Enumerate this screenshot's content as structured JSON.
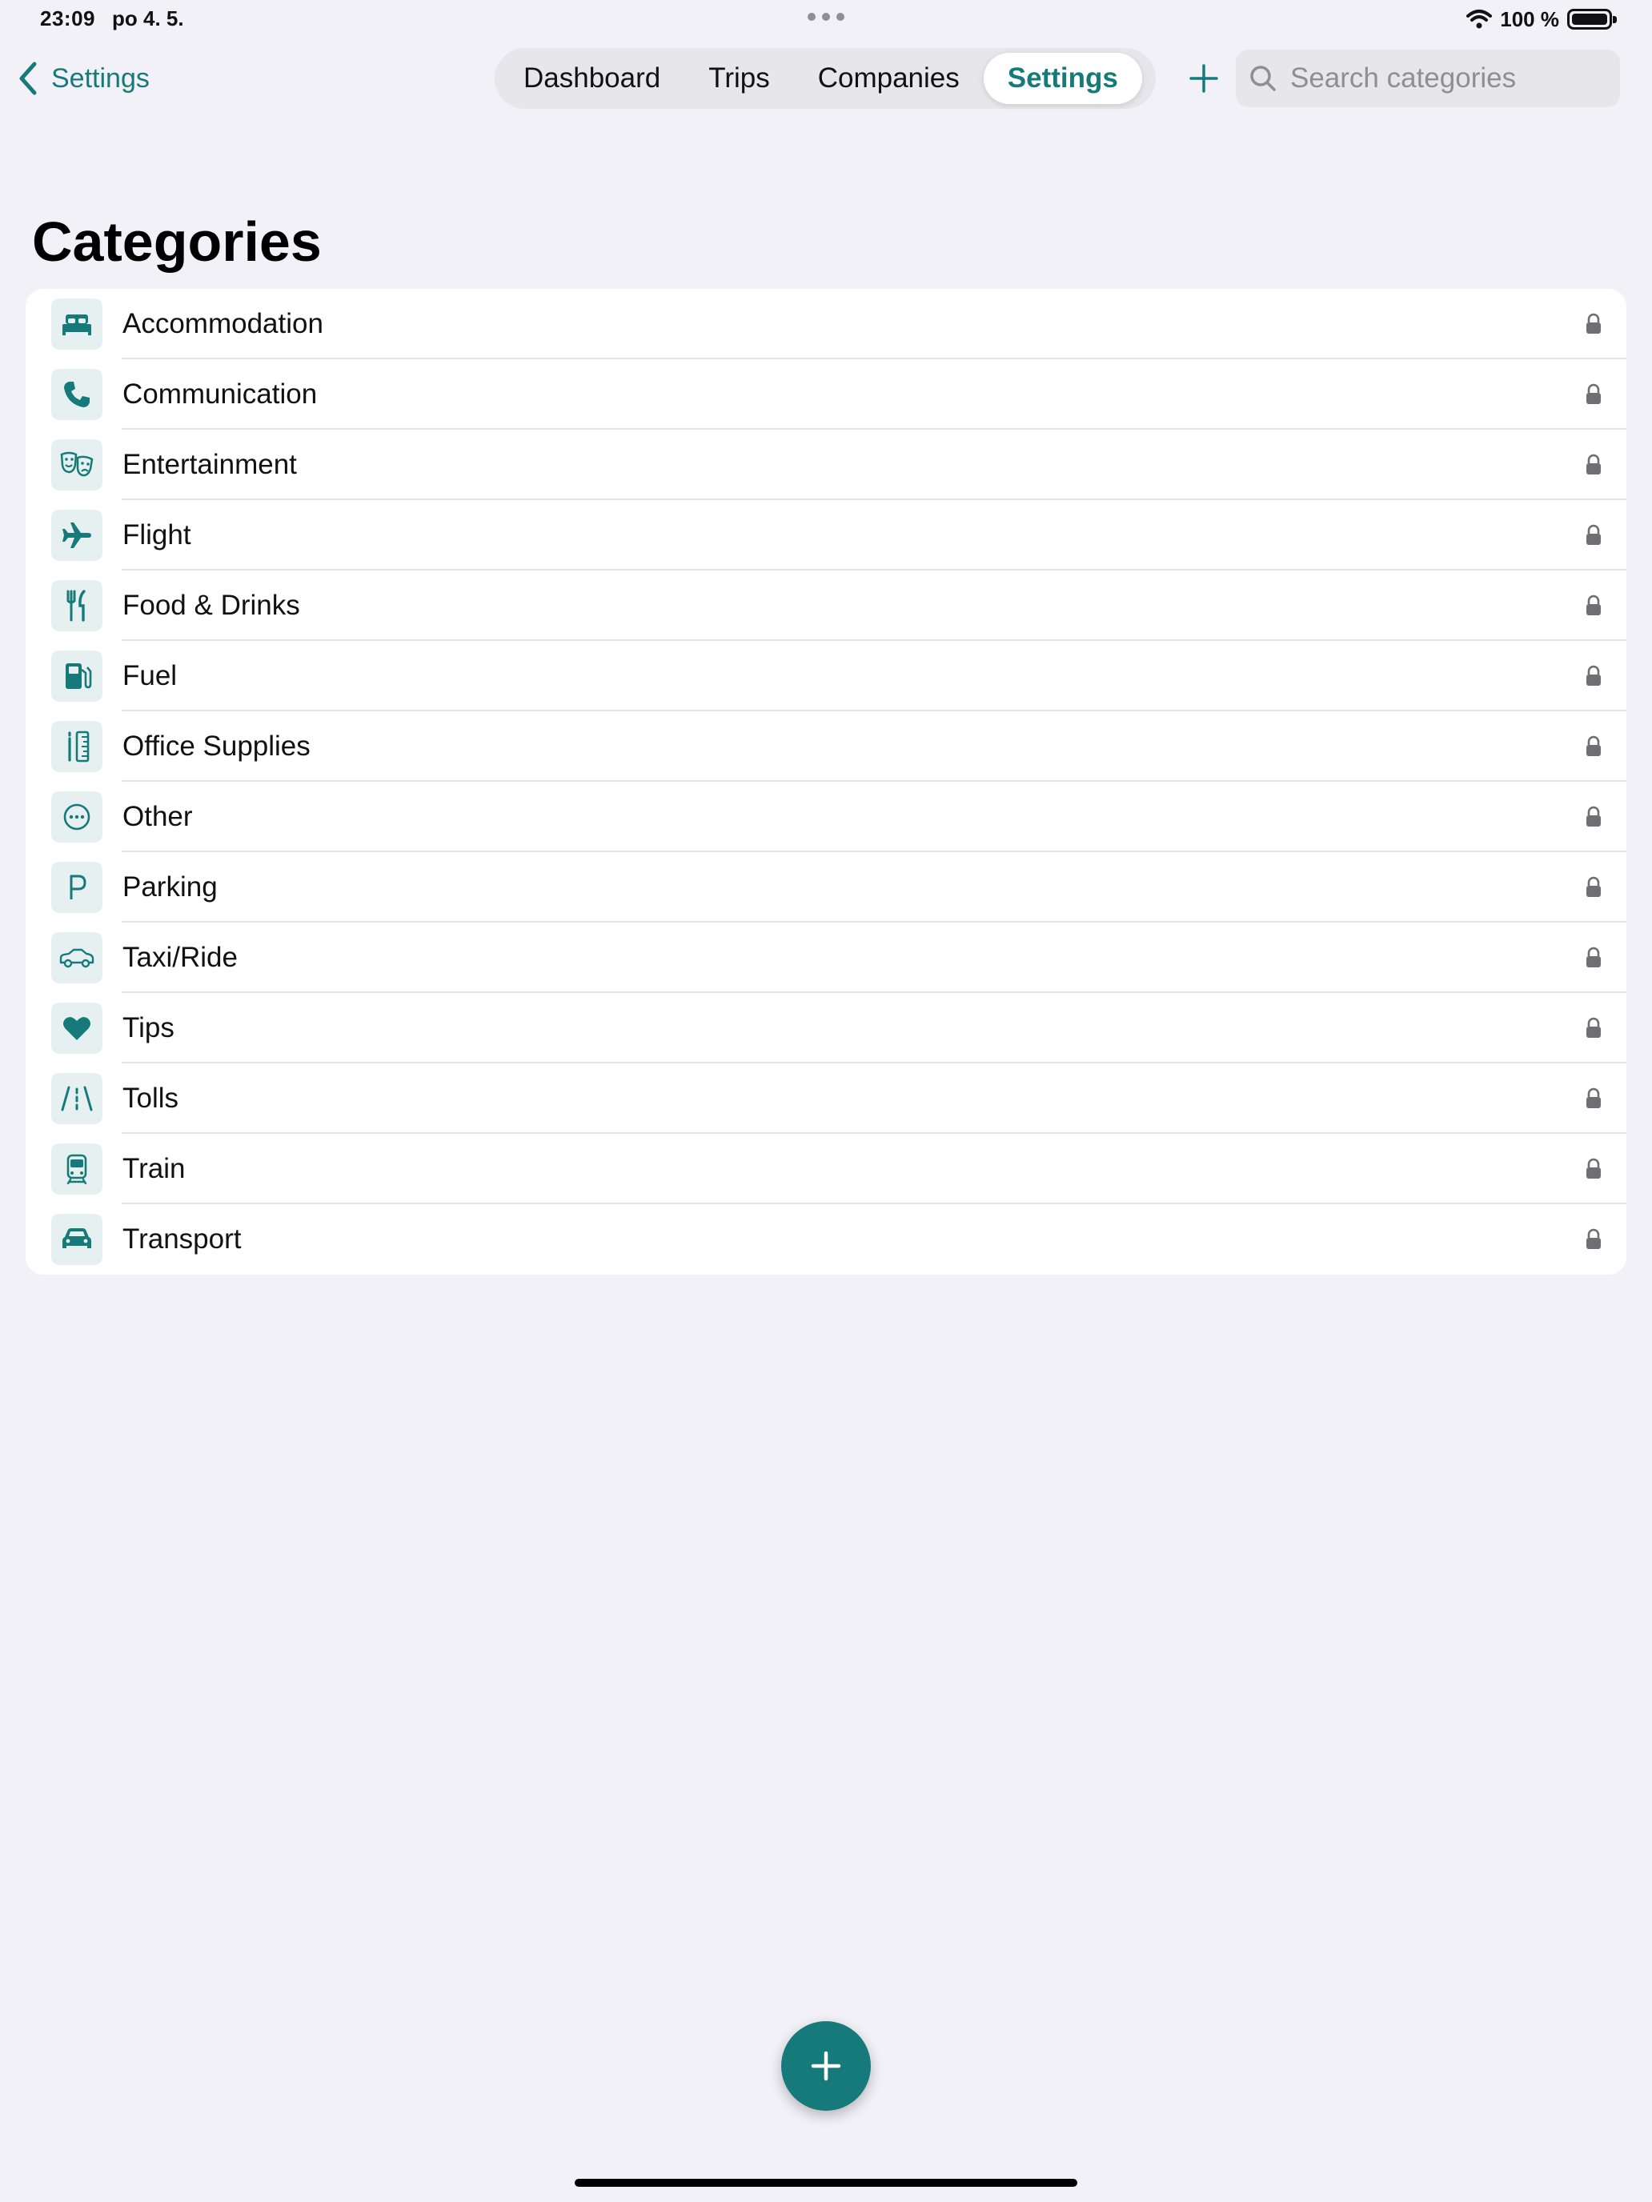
{
  "status_bar": {
    "time": "23:09",
    "date": "po 4. 5.",
    "battery": "100 %",
    "battery_level": 1.0
  },
  "nav": {
    "back_label": "Settings",
    "tabs": [
      {
        "label": "Dashboard",
        "active": false
      },
      {
        "label": "Trips",
        "active": false
      },
      {
        "label": "Companies",
        "active": false
      },
      {
        "label": "Settings",
        "active": true
      }
    ]
  },
  "search": {
    "placeholder": "Search categories",
    "value": ""
  },
  "page_title": "Categories",
  "categories": [
    {
      "label": "Accommodation",
      "icon": "bed-icon",
      "locked": true
    },
    {
      "label": "Communication",
      "icon": "phone-icon",
      "locked": true
    },
    {
      "label": "Entertainment",
      "icon": "theater-masks-icon",
      "locked": true
    },
    {
      "label": "Flight",
      "icon": "airplane-icon",
      "locked": true
    },
    {
      "label": "Food & Drinks",
      "icon": "fork-knife-icon",
      "locked": true
    },
    {
      "label": "Fuel",
      "icon": "fuel-pump-icon",
      "locked": true
    },
    {
      "label": "Office Supplies",
      "icon": "pencil-ruler-icon",
      "locked": true
    },
    {
      "label": "Other",
      "icon": "ellipsis-circle-icon",
      "locked": true
    },
    {
      "label": "Parking",
      "icon": "parking-icon",
      "locked": true
    },
    {
      "label": "Taxi/Ride",
      "icon": "car-side-icon",
      "locked": true
    },
    {
      "label": "Tips",
      "icon": "heart-icon",
      "locked": true
    },
    {
      "label": "Tolls",
      "icon": "road-icon",
      "locked": true
    },
    {
      "label": "Train",
      "icon": "tram-icon",
      "locked": true
    },
    {
      "label": "Transport",
      "icon": "car-icon",
      "locked": true
    }
  ],
  "colors": {
    "accent": "#177a7a",
    "background": "#f2f1f7",
    "icon_bg": "#e6f0f0",
    "lock": "#6e6e73"
  }
}
